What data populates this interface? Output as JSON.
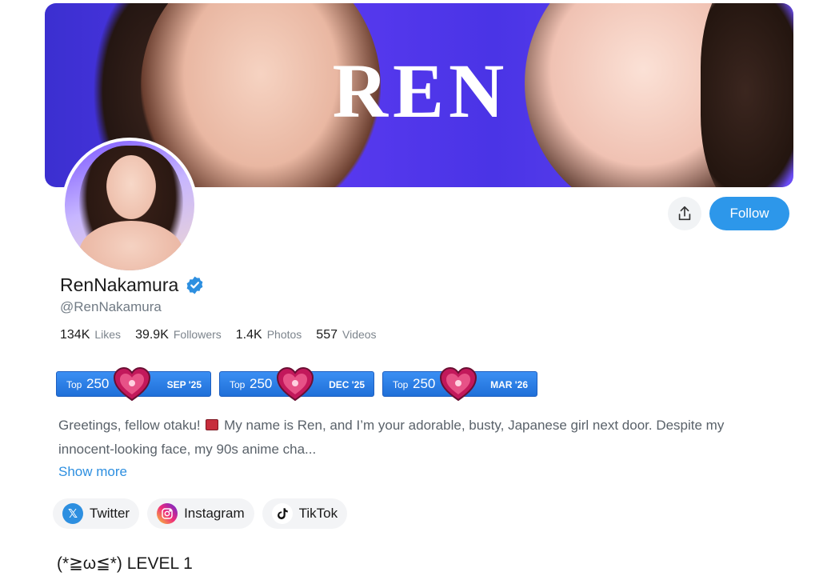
{
  "banner": {
    "brand_text": "REN"
  },
  "actions": {
    "share_icon": "share-icon",
    "follow_label": "Follow"
  },
  "profile": {
    "display_name": "RenNakamura",
    "handle": "@RenNakamura",
    "verified": true
  },
  "stats": [
    {
      "value": "134K",
      "label": "Likes"
    },
    {
      "value": "39.9K",
      "label": "Followers"
    },
    {
      "value": "1.4K",
      "label": "Photos"
    },
    {
      "value": "557",
      "label": "Videos"
    }
  ],
  "badges": [
    {
      "top": "Top",
      "rank": "250",
      "date": "SEP '25"
    },
    {
      "top": "Top",
      "rank": "250",
      "date": "DEC '25"
    },
    {
      "top": "Top",
      "rank": "250",
      "date": "MAR '26"
    }
  ],
  "bio": {
    "part1": "Greetings, fellow otaku!",
    "part2": "My name is Ren, and I’m your adorable, busty, Japanese girl next door. Despite my innocent-looking face, my 90s anime cha...",
    "show_more": "Show more"
  },
  "socials": [
    {
      "name": "Twitter",
      "icon": "x-icon"
    },
    {
      "name": "Instagram",
      "icon": "instagram-icon"
    },
    {
      "name": "TikTok",
      "icon": "tiktok-icon"
    }
  ],
  "level": {
    "text": "(*≧ω≦*) LEVEL 1"
  },
  "colors": {
    "accent": "#2d97ea",
    "badge": "#2a7fe6"
  }
}
